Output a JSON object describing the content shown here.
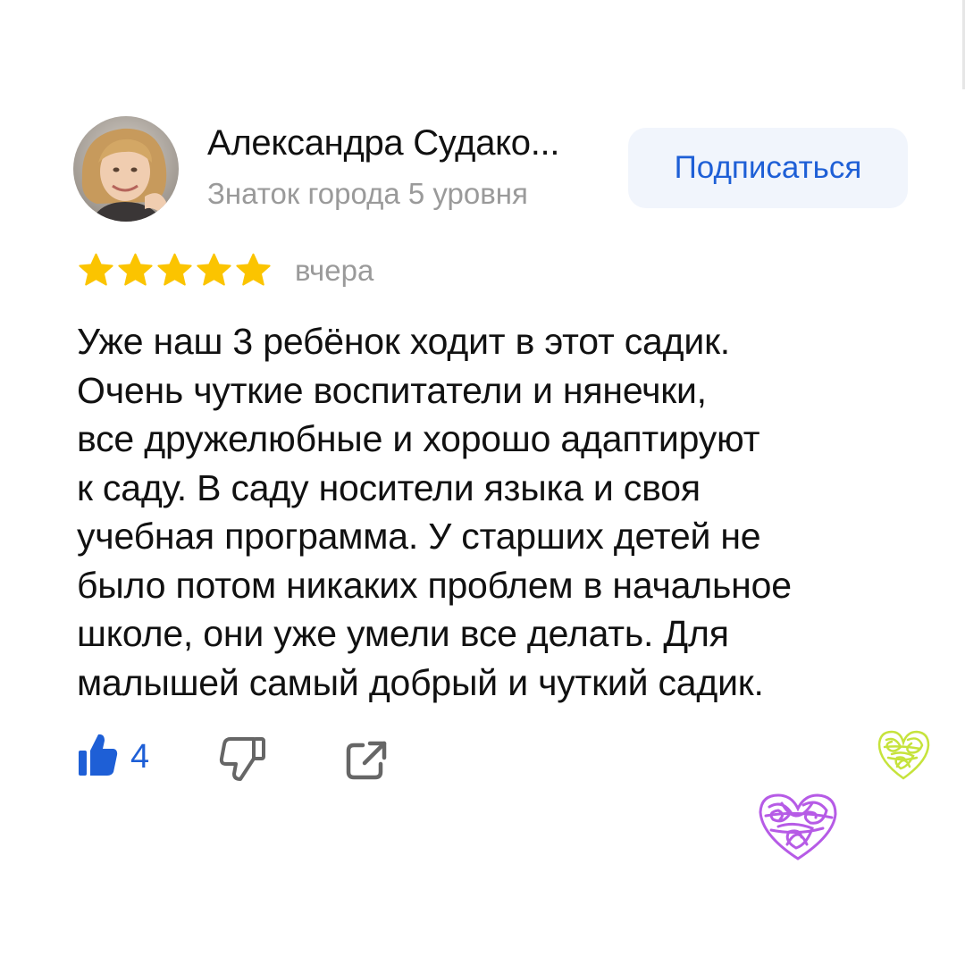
{
  "author": {
    "name": "Александра Судако...",
    "level": "Знаток города 5 уровня"
  },
  "subscribe": {
    "label": "Подписаться"
  },
  "rating": {
    "stars": 5,
    "max": 5,
    "date": "вчера"
  },
  "review": {
    "lines": [
      "Уже наш 3 ребёнок ходит в этот садик.",
      "Очень чуткие воспитатели и нянечки,",
      "все дружелюбные и хорошо адаптируют",
      "к саду. В саду носители языка и своя",
      "учебная программа. У старших детей не",
      "было потом никаких проблем в начальное",
      "школе, они уже умели все делать. Для",
      "малышей самый добрый и чуткий садик."
    ]
  },
  "actions": {
    "like_count": "4"
  },
  "colors": {
    "accent": "#1e5fd6",
    "star": "#fbc400",
    "muted_text": "#9a9a9a",
    "button_bg": "#f1f5fc",
    "heart_green": "#c6e33c",
    "heart_purple": "#b65be6"
  }
}
